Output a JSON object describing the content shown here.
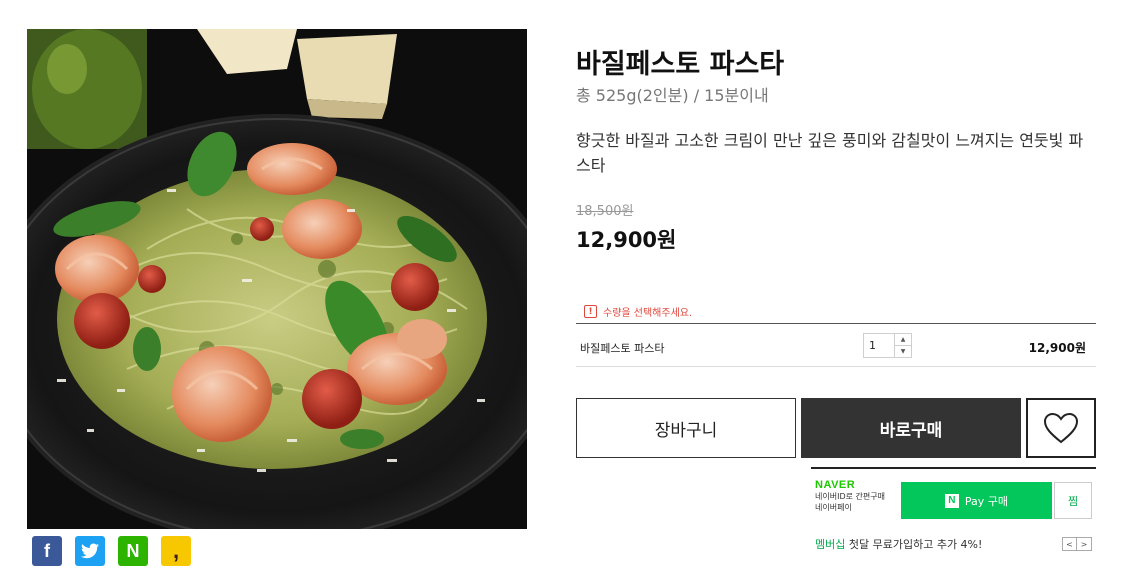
{
  "product": {
    "title": "바질페스토 파스타",
    "subtitle": "총 525g(2인분) / 15분이내",
    "description": "향긋한 바질과 고소한 크림이 만난 깊은 풍미와 감칠맛이 느껴지는 연둣빛 파스타",
    "original_price": "18,500원",
    "sale_price": "12,900원"
  },
  "share": {
    "facebook": "f",
    "twitter": "t",
    "naver": "N",
    "kakao": ","
  },
  "order": {
    "warning": "수량을 선택해주세요.",
    "warning_icon": "!",
    "option_name": "바질페스토 파스타",
    "quantity": "1",
    "qty_up": "▲",
    "qty_down": "▼",
    "option_price": "12,900원"
  },
  "actions": {
    "cart_label": "장바구니",
    "buy_label": "바로구매",
    "wish_icon": "heart-icon"
  },
  "npay": {
    "brand": "NAVER",
    "line1": "네이버ID로 간편구매",
    "line2": "네이버페이",
    "button_n": "N",
    "button_label": "Pay 구매",
    "zzim_label": "찜",
    "member_highlight": "멤버십",
    "member_text": " 첫달 무료가입하고 추가 4%!",
    "prev": "<",
    "next": ">"
  },
  "colors": {
    "naver_green": "#03c75a",
    "buy_button": "#333333",
    "warning": "#e0483e"
  }
}
